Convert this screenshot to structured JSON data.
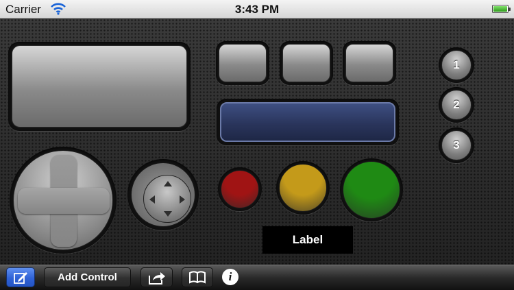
{
  "status_bar": {
    "carrier": "Carrier",
    "time": "3:43 PM",
    "wifi_icon": "wifi-icon",
    "battery_icon": "battery-icon"
  },
  "controls": {
    "number_buttons": [
      "1",
      "2",
      "3"
    ],
    "label_text": "Label",
    "display_color": "#2a355c",
    "round_buttons": [
      {
        "name": "red",
        "color": "#a01414"
      },
      {
        "name": "yellow",
        "color": "#c49a1a"
      },
      {
        "name": "green",
        "color": "#1f8a14"
      }
    ]
  },
  "toolbar": {
    "edit_icon": "edit-icon",
    "add_control_label": "Add Control",
    "share_icon": "share-icon",
    "book_icon": "book-icon",
    "info_icon": "info-icon",
    "info_glyph": "i"
  }
}
